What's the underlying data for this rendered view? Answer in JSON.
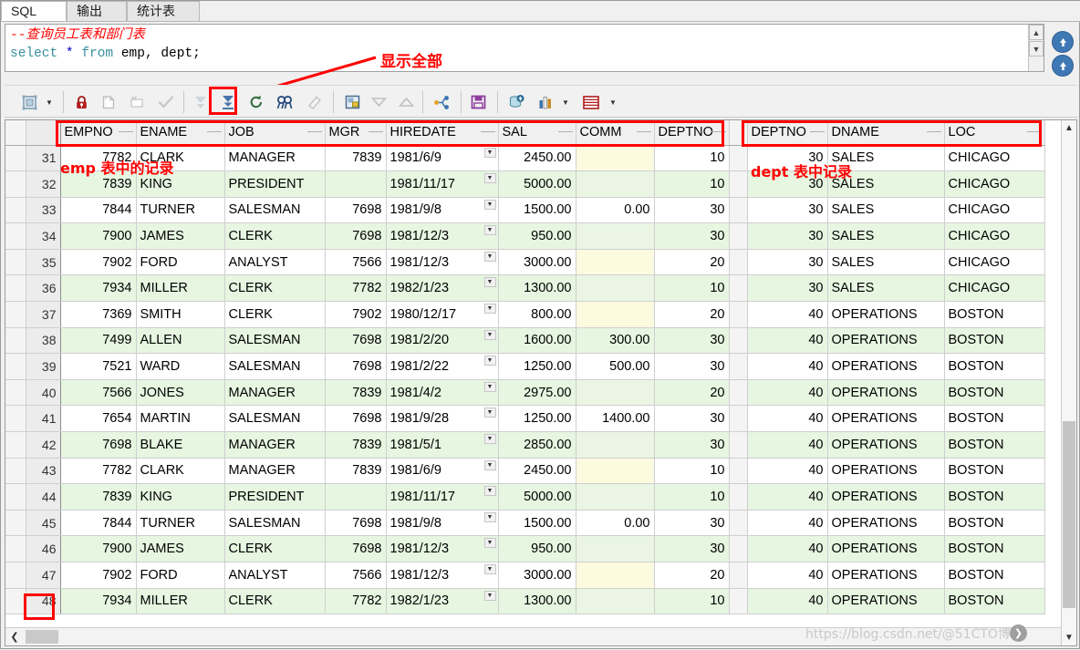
{
  "tabs": [
    {
      "label": "SQL",
      "active": true
    },
    {
      "label": "输出",
      "active": false
    },
    {
      "label": "统计表",
      "active": false
    }
  ],
  "editor": {
    "comment": "--查询员工表和部门表",
    "keyword_select": "select",
    "star": "*",
    "keyword_from": "from",
    "tables": "emp, dept;",
    "scroll_up_icon": "chevron-up-icon",
    "scroll_down_icon": "chevron-down-icon"
  },
  "side_buttons": [
    {
      "name": "scroll-up-round-button",
      "glyph": "↑"
    },
    {
      "name": "scroll-down-round-button",
      "glyph": "↑"
    }
  ],
  "annotations": {
    "show_all": "显示全部",
    "emp_records": "emp 表中的记录",
    "dept_records": "dept 表中记录"
  },
  "toolbar": {
    "items": [
      {
        "name": "grid-mode-icon",
        "label": "Grid"
      },
      {
        "name": "grid-mode-dropdown-icon",
        "label": "▼"
      },
      {
        "name": "lock-record-icon",
        "label": "Lock"
      },
      {
        "name": "insert-record-icon",
        "label": "Insert Record"
      },
      {
        "name": "delete-record-icon",
        "label": "Delete Record"
      },
      {
        "name": "post-changes-icon",
        "label": "Post Changes"
      },
      {
        "name": "fetch-next-page-icon",
        "label": "Fetch Next Page"
      },
      {
        "name": "fetch-all-rows-icon",
        "label": "Fetch All Rows"
      },
      {
        "name": "refresh-icon",
        "label": "Refresh"
      },
      {
        "name": "find-icon",
        "label": "Find"
      },
      {
        "name": "clear-filter-icon",
        "label": "Clear Filter"
      },
      {
        "name": "export-data-icon",
        "label": "Export Data"
      },
      {
        "name": "sort-descending-icon",
        "label": "Sort Desc"
      },
      {
        "name": "sort-ascending-icon",
        "label": "Sort Asc"
      },
      {
        "name": "hierarchy-icon",
        "label": "Hierarchy"
      },
      {
        "name": "save-icon",
        "label": "Save"
      },
      {
        "name": "database-upload-icon",
        "label": "Commit"
      },
      {
        "name": "chart-icon",
        "label": "Chart"
      },
      {
        "name": "chart-dropdown-icon",
        "label": "▼"
      },
      {
        "name": "table-view-icon",
        "label": "Table View"
      },
      {
        "name": "table-view-dropdown-icon",
        "label": "▼"
      }
    ]
  },
  "grid": {
    "emp_columns": [
      "EMPNO",
      "ENAME",
      "JOB",
      "MGR",
      "HIREDATE",
      "SAL",
      "COMM",
      "DEPTNO"
    ],
    "dept_columns": [
      "DEPTNO",
      "DNAME",
      "LOC"
    ],
    "rows": [
      {
        "n": "31",
        "EMPNO": "7782",
        "ENAME": "CLARK",
        "JOB": "MANAGER",
        "MGR": "7839",
        "HIREDATE": "1981/6/9",
        "SAL": "2450.00",
        "COMM": "",
        "DEPTNO": "10",
        "D_DEPTNO": "30",
        "DNAME": "SALES",
        "LOC": "CHICAGO"
      },
      {
        "n": "32",
        "EMPNO": "7839",
        "ENAME": "KING",
        "JOB": "PRESIDENT",
        "MGR": "",
        "HIREDATE": "1981/11/17",
        "SAL": "5000.00",
        "COMM": "",
        "DEPTNO": "10",
        "D_DEPTNO": "30",
        "DNAME": "SALES",
        "LOC": "CHICAGO"
      },
      {
        "n": "33",
        "EMPNO": "7844",
        "ENAME": "TURNER",
        "JOB": "SALESMAN",
        "MGR": "7698",
        "HIREDATE": "1981/9/8",
        "SAL": "1500.00",
        "COMM": "0.00",
        "DEPTNO": "30",
        "D_DEPTNO": "30",
        "DNAME": "SALES",
        "LOC": "CHICAGO"
      },
      {
        "n": "34",
        "EMPNO": "7900",
        "ENAME": "JAMES",
        "JOB": "CLERK",
        "MGR": "7698",
        "HIREDATE": "1981/12/3",
        "SAL": "950.00",
        "COMM": "",
        "DEPTNO": "30",
        "D_DEPTNO": "30",
        "DNAME": "SALES",
        "LOC": "CHICAGO"
      },
      {
        "n": "35",
        "EMPNO": "7902",
        "ENAME": "FORD",
        "JOB": "ANALYST",
        "MGR": "7566",
        "HIREDATE": "1981/12/3",
        "SAL": "3000.00",
        "COMM": "",
        "DEPTNO": "20",
        "D_DEPTNO": "30",
        "DNAME": "SALES",
        "LOC": "CHICAGO"
      },
      {
        "n": "36",
        "EMPNO": "7934",
        "ENAME": "MILLER",
        "JOB": "CLERK",
        "MGR": "7782",
        "HIREDATE": "1982/1/23",
        "SAL": "1300.00",
        "COMM": "",
        "DEPTNO": "10",
        "D_DEPTNO": "30",
        "DNAME": "SALES",
        "LOC": "CHICAGO"
      },
      {
        "n": "37",
        "EMPNO": "7369",
        "ENAME": "SMITH",
        "JOB": "CLERK",
        "MGR": "7902",
        "HIREDATE": "1980/12/17",
        "SAL": "800.00",
        "COMM": "",
        "DEPTNO": "20",
        "D_DEPTNO": "40",
        "DNAME": "OPERATIONS",
        "LOC": "BOSTON"
      },
      {
        "n": "38",
        "EMPNO": "7499",
        "ENAME": "ALLEN",
        "JOB": "SALESMAN",
        "MGR": "7698",
        "HIREDATE": "1981/2/20",
        "SAL": "1600.00",
        "COMM": "300.00",
        "DEPTNO": "30",
        "D_DEPTNO": "40",
        "DNAME": "OPERATIONS",
        "LOC": "BOSTON"
      },
      {
        "n": "39",
        "EMPNO": "7521",
        "ENAME": "WARD",
        "JOB": "SALESMAN",
        "MGR": "7698",
        "HIREDATE": "1981/2/22",
        "SAL": "1250.00",
        "COMM": "500.00",
        "DEPTNO": "30",
        "D_DEPTNO": "40",
        "DNAME": "OPERATIONS",
        "LOC": "BOSTON"
      },
      {
        "n": "40",
        "EMPNO": "7566",
        "ENAME": "JONES",
        "JOB": "MANAGER",
        "MGR": "7839",
        "HIREDATE": "1981/4/2",
        "SAL": "2975.00",
        "COMM": "",
        "DEPTNO": "20",
        "D_DEPTNO": "40",
        "DNAME": "OPERATIONS",
        "LOC": "BOSTON"
      },
      {
        "n": "41",
        "EMPNO": "7654",
        "ENAME": "MARTIN",
        "JOB": "SALESMAN",
        "MGR": "7698",
        "HIREDATE": "1981/9/28",
        "SAL": "1250.00",
        "COMM": "1400.00",
        "DEPTNO": "30",
        "D_DEPTNO": "40",
        "DNAME": "OPERATIONS",
        "LOC": "BOSTON"
      },
      {
        "n": "42",
        "EMPNO": "7698",
        "ENAME": "BLAKE",
        "JOB": "MANAGER",
        "MGR": "7839",
        "HIREDATE": "1981/5/1",
        "SAL": "2850.00",
        "COMM": "",
        "DEPTNO": "30",
        "D_DEPTNO": "40",
        "DNAME": "OPERATIONS",
        "LOC": "BOSTON"
      },
      {
        "n": "43",
        "EMPNO": "7782",
        "ENAME": "CLARK",
        "JOB": "MANAGER",
        "MGR": "7839",
        "HIREDATE": "1981/6/9",
        "SAL": "2450.00",
        "COMM": "",
        "DEPTNO": "10",
        "D_DEPTNO": "40",
        "DNAME": "OPERATIONS",
        "LOC": "BOSTON"
      },
      {
        "n": "44",
        "EMPNO": "7839",
        "ENAME": "KING",
        "JOB": "PRESIDENT",
        "MGR": "",
        "HIREDATE": "1981/11/17",
        "SAL": "5000.00",
        "COMM": "",
        "DEPTNO": "10",
        "D_DEPTNO": "40",
        "DNAME": "OPERATIONS",
        "LOC": "BOSTON"
      },
      {
        "n": "45",
        "EMPNO": "7844",
        "ENAME": "TURNER",
        "JOB": "SALESMAN",
        "MGR": "7698",
        "HIREDATE": "1981/9/8",
        "SAL": "1500.00",
        "COMM": "0.00",
        "DEPTNO": "30",
        "D_DEPTNO": "40",
        "DNAME": "OPERATIONS",
        "LOC": "BOSTON"
      },
      {
        "n": "46",
        "EMPNO": "7900",
        "ENAME": "JAMES",
        "JOB": "CLERK",
        "MGR": "7698",
        "HIREDATE": "1981/12/3",
        "SAL": "950.00",
        "COMM": "",
        "DEPTNO": "30",
        "D_DEPTNO": "40",
        "DNAME": "OPERATIONS",
        "LOC": "BOSTON"
      },
      {
        "n": "47",
        "EMPNO": "7902",
        "ENAME": "FORD",
        "JOB": "ANALYST",
        "MGR": "7566",
        "HIREDATE": "1981/12/3",
        "SAL": "3000.00",
        "COMM": "",
        "DEPTNO": "20",
        "D_DEPTNO": "40",
        "DNAME": "OPERATIONS",
        "LOC": "BOSTON"
      },
      {
        "n": "48",
        "EMPNO": "7934",
        "ENAME": "MILLER",
        "JOB": "CLERK",
        "MGR": "7782",
        "HIREDATE": "1982/1/23",
        "SAL": "1300.00",
        "COMM": "",
        "DEPTNO": "10",
        "D_DEPTNO": "40",
        "DNAME": "OPERATIONS",
        "LOC": "BOSTON"
      }
    ]
  },
  "scrollbars": {
    "v_up_icon": "chevron-up-icon",
    "v_down_icon": "chevron-down-icon",
    "h_left_icon": "chevron-left-icon"
  },
  "watermark": {
    "text": "https://blog.csdn.net/@51CTO博客",
    "badge": "❯"
  },
  "colors": {
    "accent_red": "#ff0000",
    "row_green": "#e6f6e1",
    "null_yellow": "#fcfadf",
    "blue_button": "#3e79b5"
  }
}
